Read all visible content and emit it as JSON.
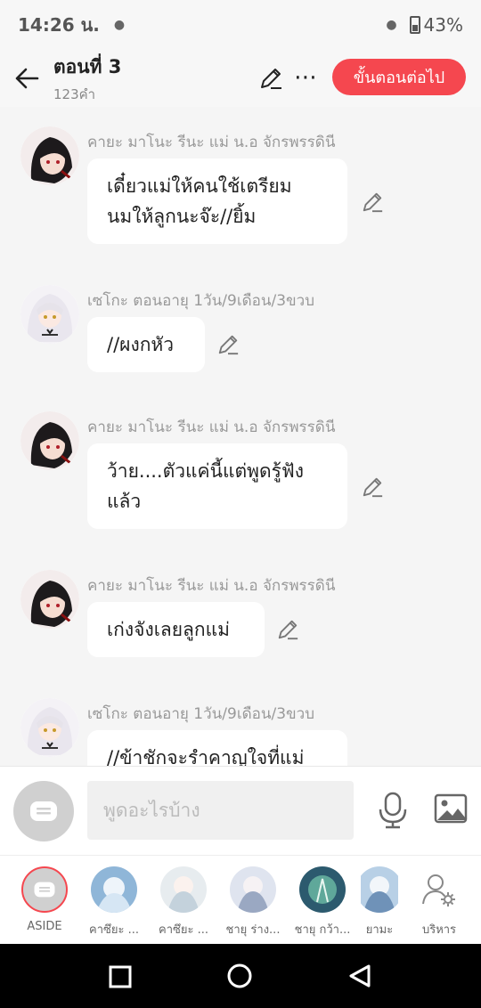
{
  "status": {
    "time": "14:26 น.",
    "battery": "43%"
  },
  "header": {
    "title": "ตอนที่ 3",
    "subtitle": "123คำ",
    "next_label": "ขั้นตอนต่อไป"
  },
  "messages": [
    {
      "sender": "คายะ มาโนะ รีนะ แม่ น.อ จักรพรรดินี",
      "lines": [
        "เดี๋ยวแม่ให้คนใช้เตรียม",
        "นมให้ลูกนะจ๊ะ//ยิ้ม"
      ]
    },
    {
      "sender": "เซโกะ ตอนอายุ 1วัน/9เดือน/3ขวบ",
      "lines": [
        "//ผงกหัว"
      ]
    },
    {
      "sender": "คายะ มาโนะ รีนะ แม่ น.อ จักรพรรดินี",
      "lines": [
        "ว้าย....ตัวแค่นี้แต่พูดรู้ฟัง",
        "แล้ว"
      ]
    },
    {
      "sender": "คายะ มาโนะ รีนะ แม่ น.อ จักรพรรดินี",
      "lines": [
        "เก่งจังเลยลูกแม่"
      ]
    },
    {
      "sender": "เซโกะ ตอนอายุ 1วัน/9เดือน/3ขวบ",
      "lines": [
        "//ข้าชักจะรำคาญใจที่แม่"
      ]
    }
  ],
  "input": {
    "placeholder": "พูดอะไรบ้าง"
  },
  "charbar": {
    "aside_label": "ASIDE",
    "chars": [
      "คาซึยะ ...",
      "คาซึยะ ...",
      "ชายุ ร่าง...",
      "ชายุ กว้า...",
      "ยามะ"
    ],
    "manage_label": "บริหาร"
  },
  "colors": {
    "accent": "#f5474f"
  }
}
